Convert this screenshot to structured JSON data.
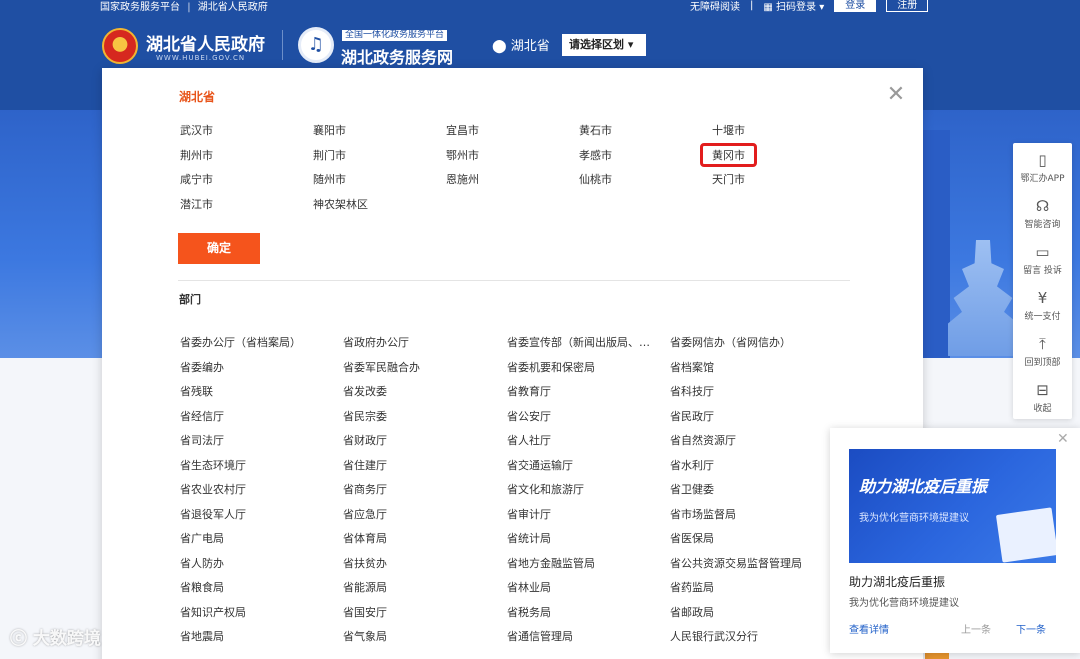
{
  "topbar": {
    "links": [
      "国家政务服务平台",
      "湖北省人民政府"
    ],
    "accessibility": "无障碍阅读",
    "scan_login": "扫码登录",
    "login": "登录",
    "register": "注册"
  },
  "header": {
    "gov_name": "湖北省人民政府",
    "gov_url": "WWW.HUBEI.GOV.CN",
    "service_tag": "全国一体化政务服务平台",
    "service_name": "湖北政务服务网",
    "location": "湖北省",
    "region_select": "请选择区划"
  },
  "modal": {
    "province_title": "湖北省",
    "cities": [
      [
        "武汉市",
        "襄阳市",
        "宜昌市",
        "黄石市",
        "十堰市"
      ],
      [
        "荆州市",
        "荆门市",
        "鄂州市",
        "孝感市",
        "黄冈市"
      ],
      [
        "咸宁市",
        "随州市",
        "恩施州",
        "仙桃市",
        "天门市"
      ],
      [
        "潜江市",
        "神农架林区"
      ]
    ],
    "highlighted_city": "黄冈市",
    "confirm": "确定",
    "dept_title": "部门",
    "departments": [
      [
        "省委办公厅（省档案局）",
        "省政府办公厅",
        "省委宣传部（新闻出版局、电影局）",
        "省委网信办（省网信办）"
      ],
      [
        "省委编办",
        "省委军民融合办",
        "省委机要和保密局",
        "省档案馆"
      ],
      [
        "省残联",
        "省发改委",
        "省教育厅",
        "省科技厅"
      ],
      [
        "省经信厅",
        "省民宗委",
        "省公安厅",
        "省民政厅"
      ],
      [
        "省司法厅",
        "省财政厅",
        "省人社厅",
        "省自然资源厅"
      ],
      [
        "省生态环境厅",
        "省住建厅",
        "省交通运输厅",
        "省水利厅"
      ],
      [
        "省农业农村厅",
        "省商务厅",
        "省文化和旅游厅",
        "省卫健委"
      ],
      [
        "省退役军人厅",
        "省应急厅",
        "省审计厅",
        "省市场监督局"
      ],
      [
        "省广电局",
        "省体育局",
        "省统计局",
        "省医保局"
      ],
      [
        "省人防办",
        "省扶贫办",
        "省地方金融监管局",
        "省公共资源交易监督管理局"
      ],
      [
        "省粮食局",
        "省能源局",
        "省林业局",
        "省药监局"
      ],
      [
        "省知识产权局",
        "省国安厅",
        "省税务局",
        "省邮政局"
      ],
      [
        "省地震局",
        "省气象局",
        "省通信管理局",
        "人民银行武汉分行"
      ]
    ]
  },
  "toolbar": [
    {
      "icon": "phone-icon",
      "glyph": "▯",
      "label": "鄂汇办APP"
    },
    {
      "icon": "headset-icon",
      "glyph": "☊",
      "label": "智能咨询"
    },
    {
      "icon": "message-icon",
      "glyph": "▭",
      "label": "留言 投诉"
    },
    {
      "icon": "yen-icon",
      "glyph": "¥",
      "label": "统一支付"
    },
    {
      "icon": "back-to-top-icon",
      "glyph": "⤒",
      "label": "回到顶部"
    },
    {
      "icon": "collapse-icon",
      "glyph": "⊟",
      "label": "收起"
    }
  ],
  "promo": {
    "image_title": "助力湖北疫后重振",
    "image_sub": "我为优化营商环境提建议",
    "title": "助力湖北疫后重振",
    "sub": "我为优化营商环境提建议",
    "detail": "查看详情",
    "prev": "上一条",
    "next": "下一条"
  },
  "watermark": "大数跨境",
  "colors": {
    "brand_blue": "#1f4fa3",
    "accent_orange": "#f5541c",
    "highlight_red": "#e21d1d"
  }
}
